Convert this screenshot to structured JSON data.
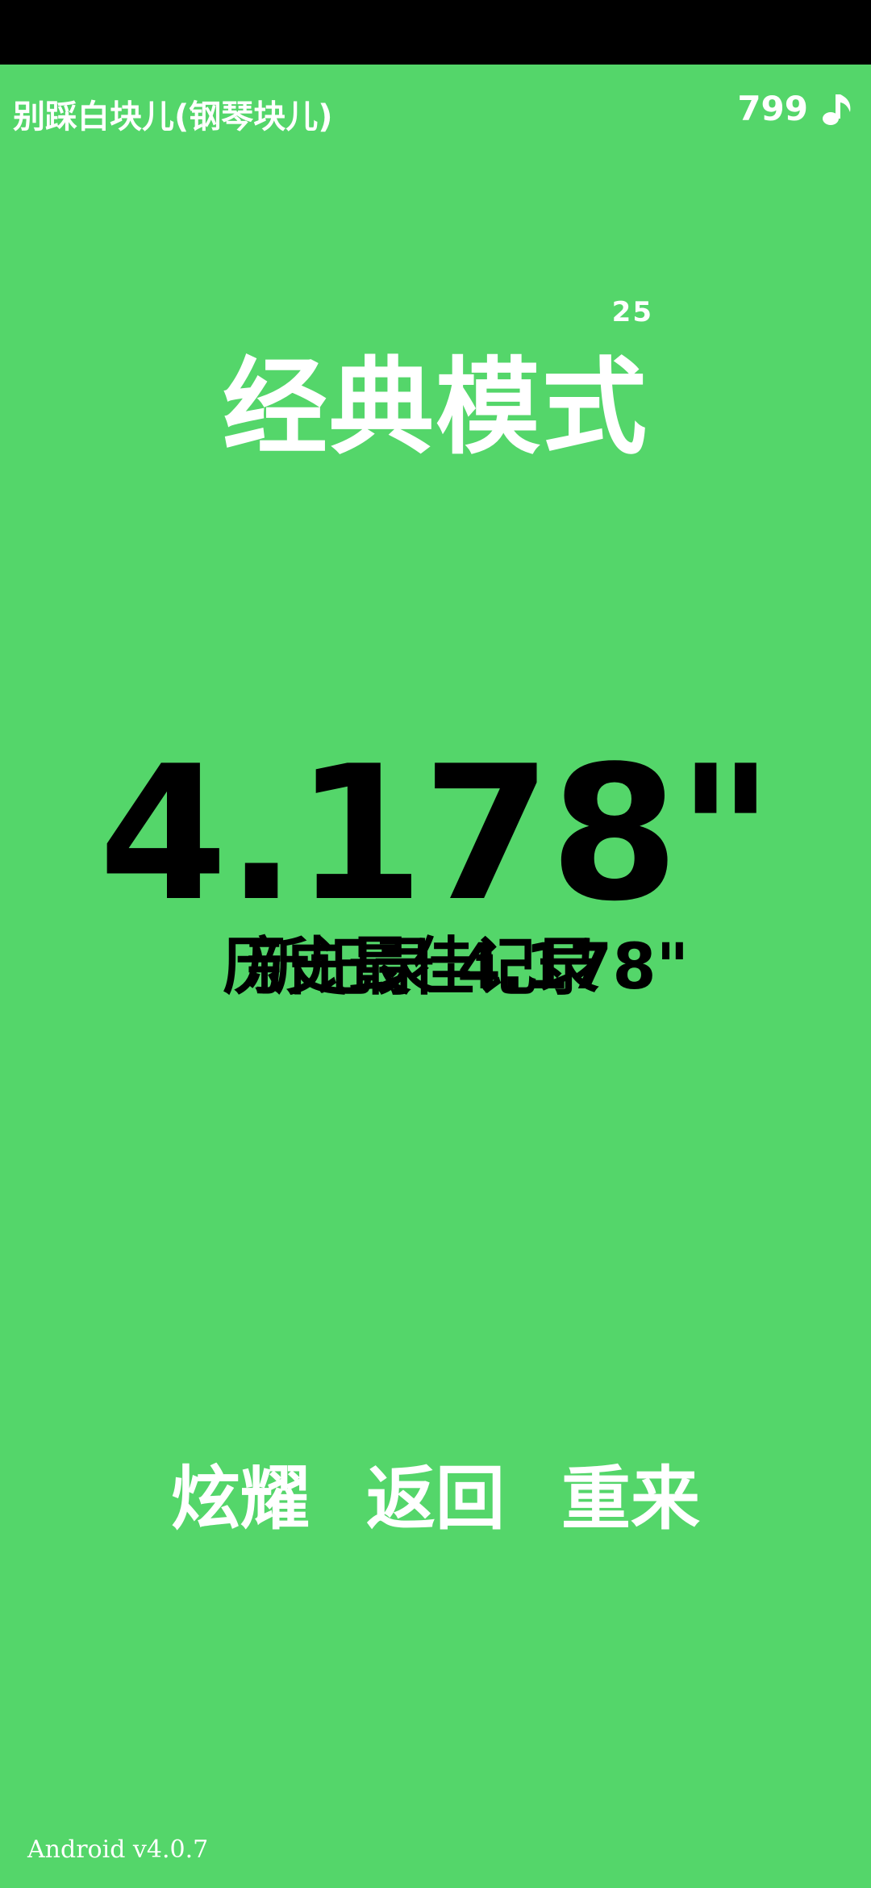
{
  "header": {
    "app_title": "别踩白块儿(钢琴块儿)",
    "coins": "799",
    "coin_icon": "music-note-icon"
  },
  "mode": {
    "title": "经典模式",
    "badge": "25"
  },
  "result": {
    "score": "4.178\"",
    "record_line_1": "历史最佳记录",
    "record_line_2": "新记录 4.178\""
  },
  "actions": {
    "share_label": "炫耀",
    "back_label": "返回",
    "retry_label": "重来"
  },
  "footer": {
    "version": "Android v4.0.7"
  },
  "colors": {
    "background": "#54d66a",
    "text_light": "#ffffff",
    "text_dark": "#000000"
  }
}
